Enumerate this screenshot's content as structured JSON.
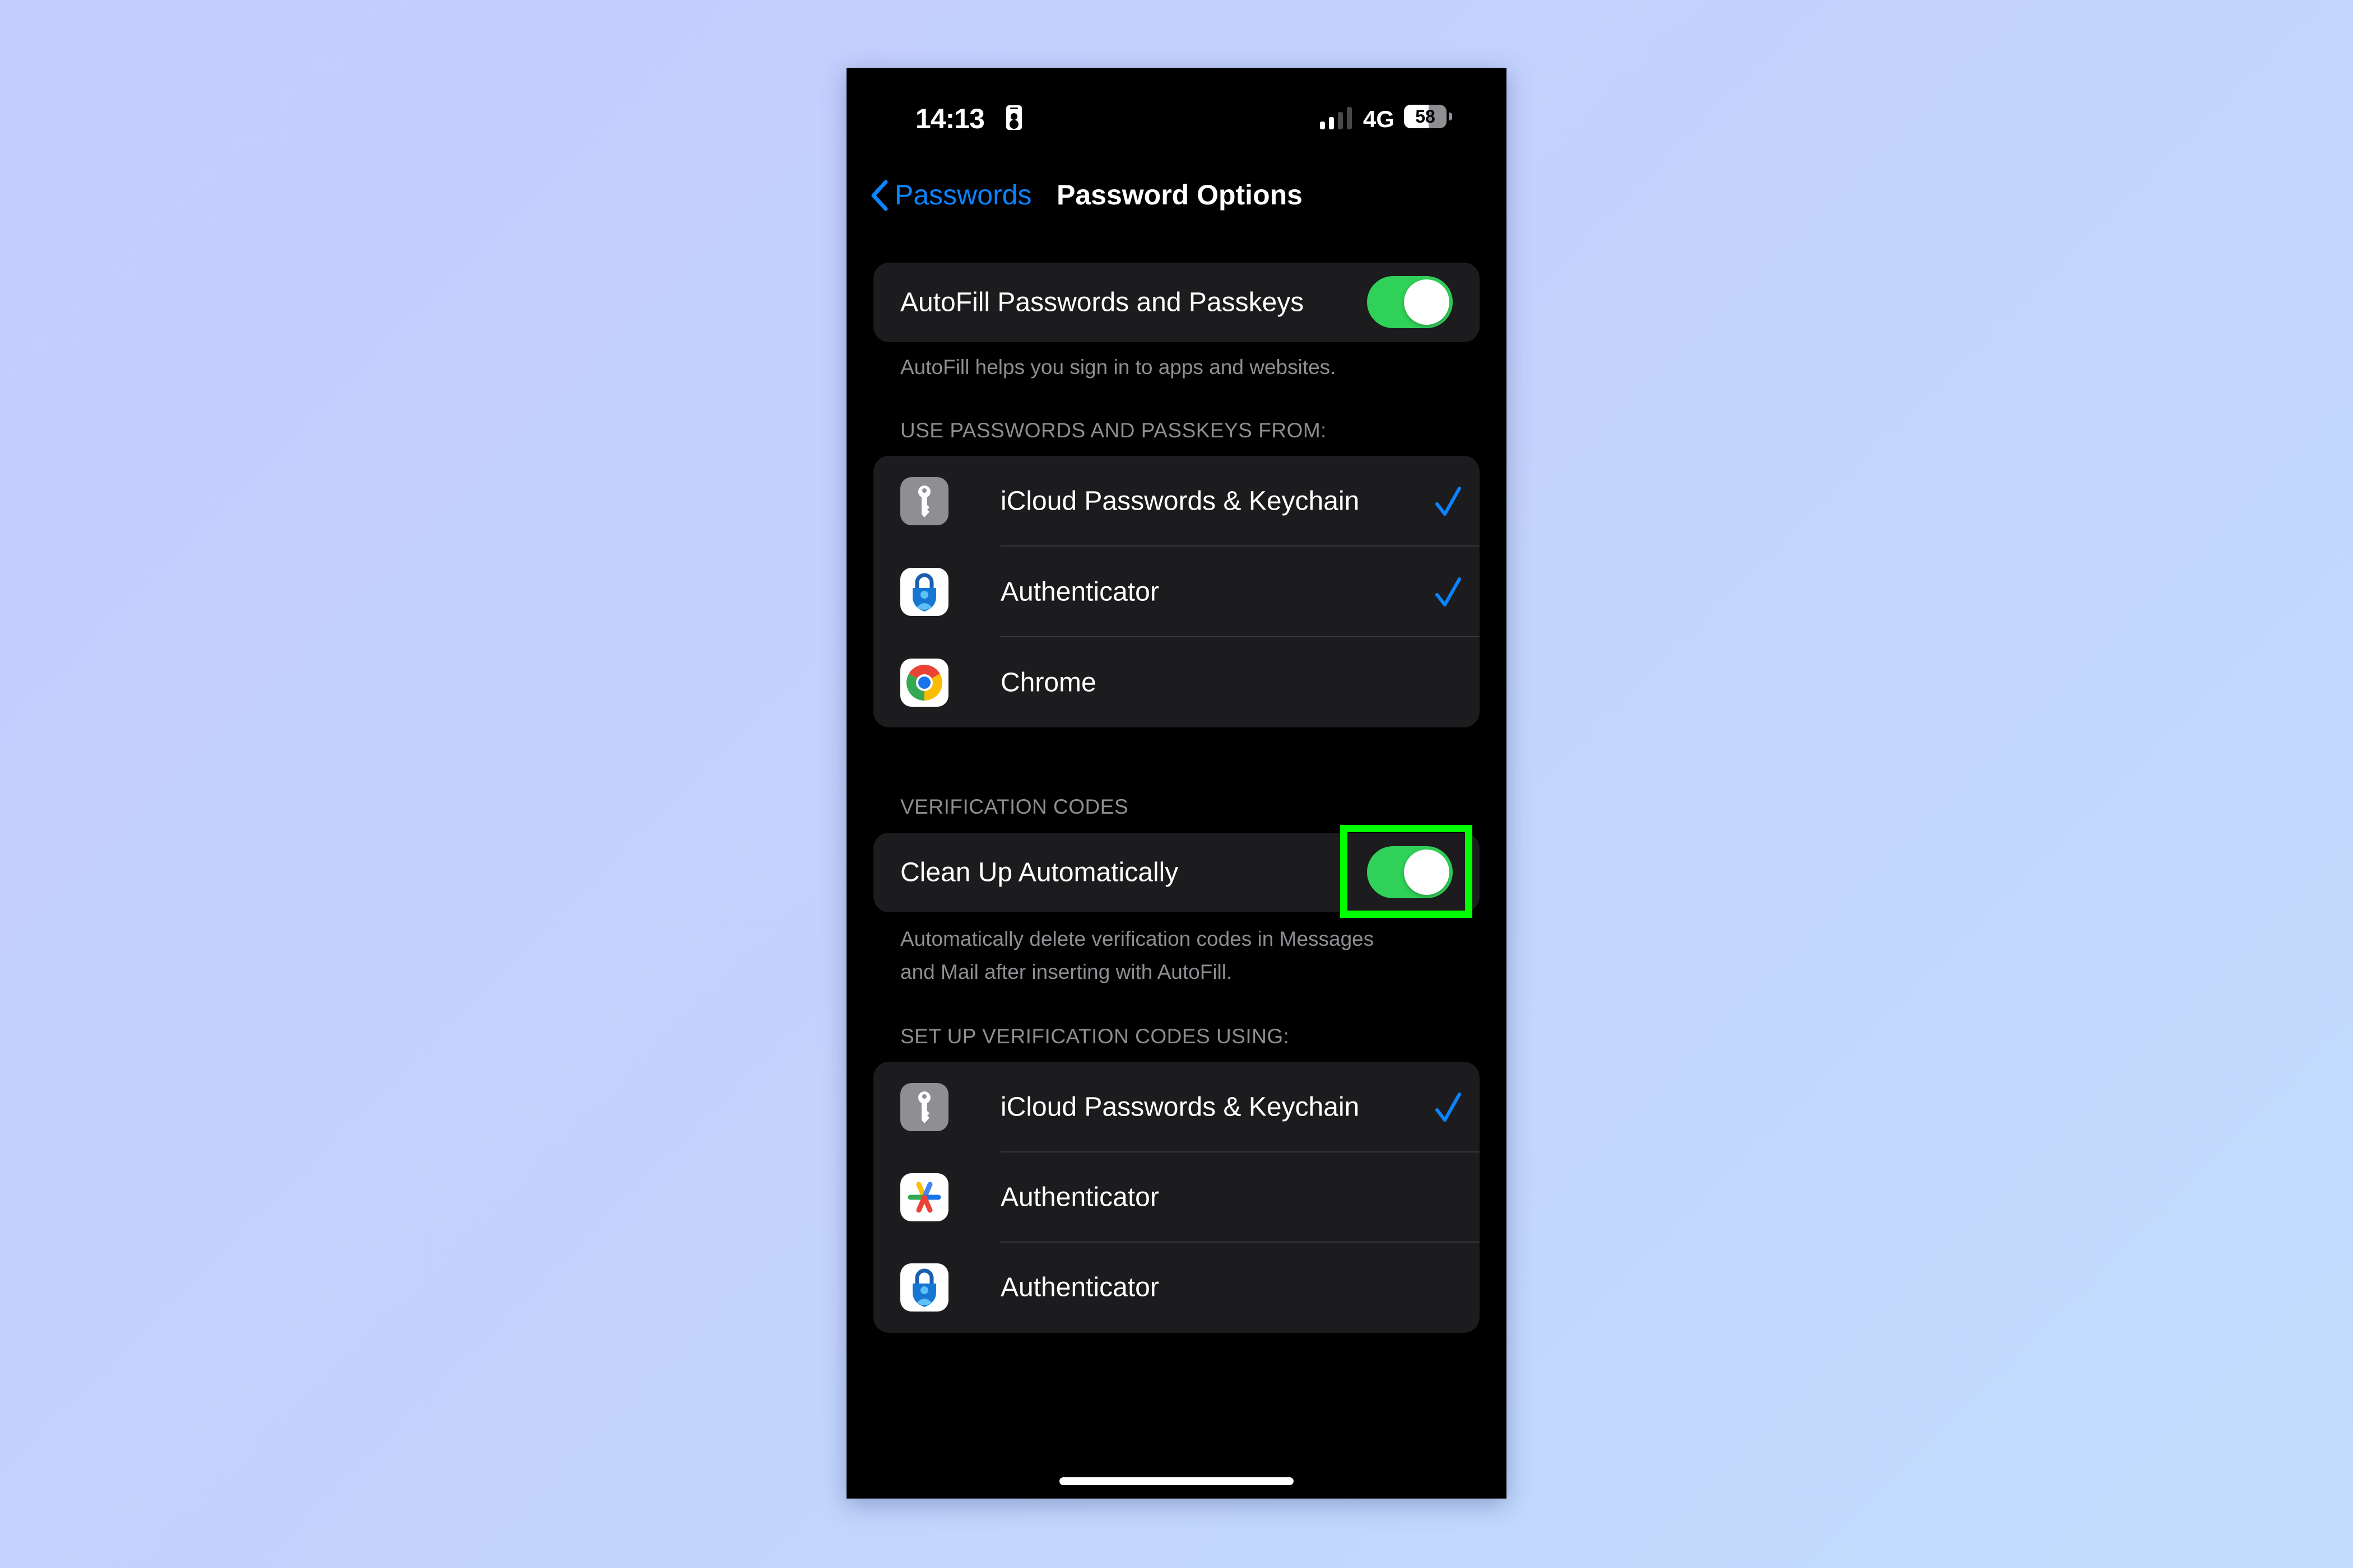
{
  "status_bar": {
    "time": "14:13",
    "network": "4G",
    "battery_percent": "58",
    "battery_level": 0.58,
    "signal_bars_active": 2,
    "signal_bars_total": 4
  },
  "nav": {
    "back_label": "Passwords",
    "title": "Password Options"
  },
  "autofill": {
    "label": "AutoFill Passwords and Passkeys",
    "enabled": true,
    "footer": "AutoFill helps you sign in to apps and websites."
  },
  "sources": {
    "header": "USE PASSWORDS AND PASSKEYS FROM:",
    "items": [
      {
        "label": "iCloud Passwords & Keychain",
        "icon": "key-icon",
        "checked": true
      },
      {
        "label": "Authenticator",
        "icon": "microsoft-authenticator-icon",
        "checked": true
      },
      {
        "label": "Chrome",
        "icon": "chrome-icon",
        "checked": false
      }
    ]
  },
  "verification": {
    "header": "VERIFICATION CODES",
    "clean_up_label": "Clean Up Automatically",
    "clean_up_enabled": true,
    "footer_line1": "Automatically delete verification codes in Messages",
    "footer_line2": "and Mail after inserting with AutoFill."
  },
  "setup": {
    "header": "SET UP VERIFICATION CODES USING:",
    "items": [
      {
        "label": "iCloud Passwords & Keychain",
        "icon": "key-icon",
        "checked": true
      },
      {
        "label": "Authenticator",
        "icon": "google-authenticator-icon",
        "checked": false
      },
      {
        "label": "Authenticator",
        "icon": "microsoft-authenticator-icon",
        "checked": false
      }
    ]
  },
  "colors": {
    "accent": "#0a84ff",
    "toggle_on": "#30d158",
    "highlight": "#00ff00",
    "card_bg": "#1c1c1e",
    "secondary_text": "#8e8e93"
  }
}
